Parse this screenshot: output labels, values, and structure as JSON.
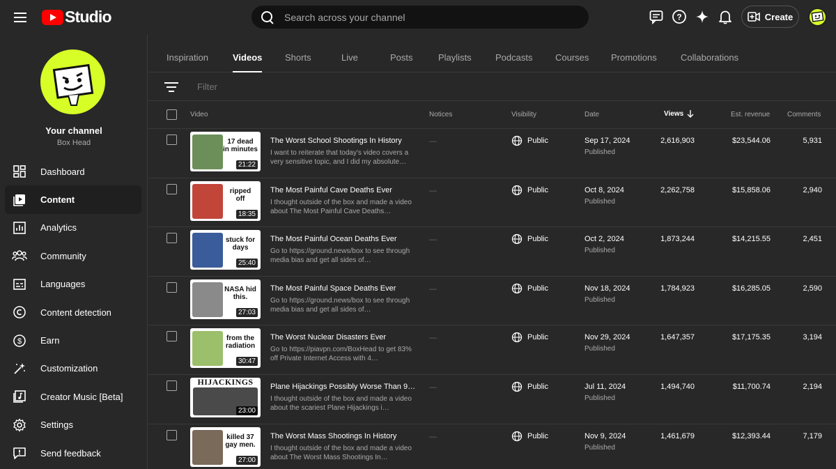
{
  "header": {
    "app_name": "Studio",
    "search_placeholder": "Search across your channel",
    "create_label": "Create"
  },
  "channel": {
    "title": "Your channel",
    "name": "Box Head"
  },
  "sidebar": {
    "items": [
      {
        "label": "Dashboard",
        "icon": "dashboard-icon"
      },
      {
        "label": "Content",
        "icon": "content-icon",
        "active": true
      },
      {
        "label": "Analytics",
        "icon": "analytics-icon"
      },
      {
        "label": "Community",
        "icon": "community-icon"
      },
      {
        "label": "Languages",
        "icon": "languages-icon"
      },
      {
        "label": "Content detection",
        "icon": "copyright-icon"
      },
      {
        "label": "Earn",
        "icon": "dollar-icon"
      },
      {
        "label": "Customization",
        "icon": "wand-icon"
      },
      {
        "label": "Creator Music [Beta]",
        "icon": "music-icon"
      },
      {
        "label": "Settings",
        "icon": "gear-icon"
      },
      {
        "label": "Send feedback",
        "icon": "feedback-icon"
      }
    ]
  },
  "tabs": [
    "Inspiration",
    "Videos",
    "Shorts",
    "Live",
    "Posts",
    "Playlists",
    "Podcasts",
    "Courses",
    "Promotions",
    "Collaborations"
  ],
  "active_tab": "Videos",
  "filter_placeholder": "Filter",
  "columns": {
    "video": "Video",
    "notices": "Notices",
    "visibility": "Visibility",
    "date": "Date",
    "views": "Views",
    "revenue": "Est. revenue",
    "comments": "Comments"
  },
  "videos": [
    {
      "title": "The Worst School Shootings In History",
      "desc": "I want to reiterate that today's video covers a very sensitive topic, and I did my absolute…",
      "notice": "—",
      "visibility": "Public",
      "date": "Sep 17, 2024",
      "status": "Published",
      "views": "2,616,903",
      "revenue": "$23,544.06",
      "comments": "5,931",
      "thumb_text": [
        "17 dead",
        "in minutes"
      ],
      "duration": "21:22",
      "thumb_color": "#6c8f5a"
    },
    {
      "title": "The Most Painful Cave Deaths Ever",
      "desc": "I thought outside of the box and made a video about The Most Painful Cave Deaths…",
      "notice": "—",
      "visibility": "Public",
      "date": "Oct 8, 2024",
      "status": "Published",
      "views": "2,262,758",
      "revenue": "$15,858.06",
      "comments": "2,940",
      "thumb_text": [
        "ripped",
        "off"
      ],
      "duration": "18:35",
      "thumb_color": "#c2453a"
    },
    {
      "title": "The Most Painful Ocean Deaths Ever",
      "desc": "Go to https://ground.news/box to see through media bias and get all sides of…",
      "notice": "—",
      "visibility": "Public",
      "date": "Oct 2, 2024",
      "status": "Published",
      "views": "1,873,244",
      "revenue": "$14,215.55",
      "comments": "2,451",
      "thumb_text": [
        "stuck for",
        "days"
      ],
      "duration": "25:40",
      "thumb_color": "#3b5c9a"
    },
    {
      "title": "The Most Painful Space Deaths Ever",
      "desc": "Go to https://ground.news/box to see through media bias and get all sides of…",
      "notice": "—",
      "visibility": "Public",
      "date": "Nov 18, 2024",
      "status": "Published",
      "views": "1,784,923",
      "revenue": "$16,285.05",
      "comments": "2,590",
      "thumb_text": [
        "NASA hid",
        "this."
      ],
      "duration": "27:03",
      "thumb_color": "#8a8a8a"
    },
    {
      "title": "The Worst Nuclear Disasters Ever",
      "desc": "Go to https://piavpn.com/BoxHead to get 83% off Private Internet Access with 4…",
      "notice": "—",
      "visibility": "Public",
      "date": "Nov 29, 2024",
      "status": "Published",
      "views": "1,647,357",
      "revenue": "$17,175.35",
      "comments": "3,194",
      "thumb_text": [
        "from the",
        "radiation"
      ],
      "duration": "30:47",
      "thumb_color": "#9bbf6a"
    },
    {
      "title": "Plane Hijackings Possibly Worse Than 9…",
      "desc": "I thought outside of the box and made a video about the scariest Plane Hijackings i…",
      "notice": "—",
      "visibility": "Public",
      "date": "Jul 11, 2024",
      "status": "Published",
      "views": "1,494,740",
      "revenue": "$11,700.74",
      "comments": "2,194",
      "thumb_text": [
        "HIJACKINGS"
      ],
      "duration": "23:00",
      "thumb_color": "#4a4a4a",
      "wide": true
    },
    {
      "title": "The Worst Mass Shootings In History",
      "desc": "I thought outside of the box and made a video about The Worst Mass Shootings In…",
      "notice": "—",
      "visibility": "Public",
      "date": "Nov 9, 2024",
      "status": "Published",
      "views": "1,461,679",
      "revenue": "$12,393.44",
      "comments": "7,179",
      "thumb_text": [
        "killed 37",
        "gay men."
      ],
      "duration": "27:00",
      "thumb_color": "#7a6a5a"
    }
  ]
}
